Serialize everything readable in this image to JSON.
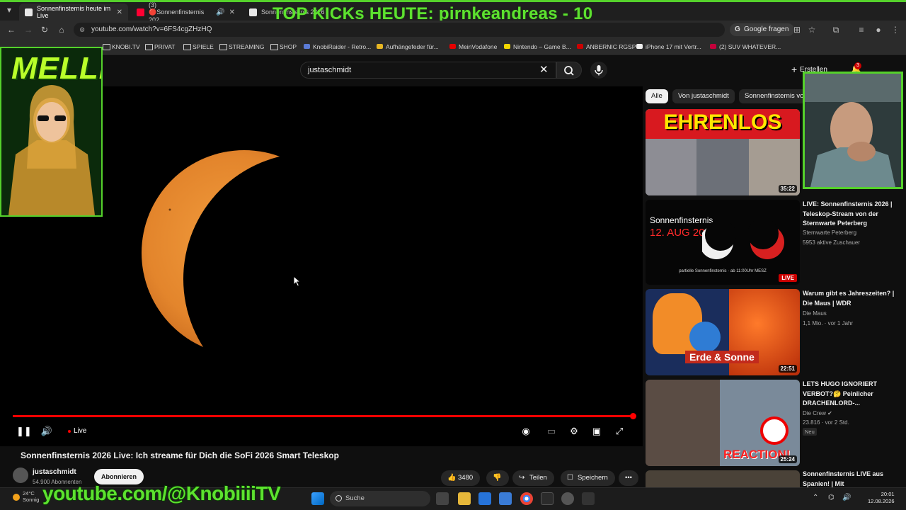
{
  "browser": {
    "tabs": [
      {
        "label": "Sonnenfinsternis heute im Live"
      },
      {
        "label": "(3) 🔴Sonnenfinsternis 202"
      },
      {
        "label": "Sonnenfinsternis 2026"
      }
    ],
    "url": "youtube.com/watch?v=6FS4cgZHzHQ",
    "google_ask": "Google fragen",
    "bookmarks": [
      "KNOBI.TV",
      "PRIVAT",
      "SPIELE",
      "STREAMING",
      "SHOP",
      "KnobiRaider - Retro...",
      "Aufhängefeder für...",
      "MeinVodafone",
      "Nintendo – Game B...",
      "ANBERNIC RGSP",
      "iPhone 17 mit Vertr...",
      "(2) SUV WHATEVER..."
    ]
  },
  "stream_overlay": {
    "banner": "TOP KICKs HEUTE: pirnkeandreas - 10",
    "melli": "MELLI",
    "youtube_handle": "youtube.com/@KnobiiiiTV"
  },
  "youtube": {
    "search_value": "justaschmidt",
    "create_label": "Erstellen",
    "notif_count": "3",
    "player": {
      "live_label": "Live",
      "progress_fraction": 0.99
    },
    "video": {
      "title": "Sonnenfinsternis 2026 Live: Ich streame für Dich die SoFi 2026 Smart Teleskop",
      "channel": "justaschmidt",
      "subscribers": "54.900 Abonnenten",
      "subscribe_label": "Abonnieren",
      "likes": "3480",
      "share_label": "Teilen",
      "save_label": "Speichern"
    },
    "chips": [
      "Alle",
      "Von justaschmidt",
      "Sonnenfinsternis vo"
    ],
    "recommendations": [
      {
        "thumb_text": "EHRENLOS",
        "duration": "35:22",
        "title": "",
        "channel": "",
        "meta": ""
      },
      {
        "thumb_title": "Sonnenfinsternis",
        "thumb_date": "12. AUG 2026",
        "thumb_caption": "partielle Sonnenfinsternis · ab 11:00Uhr MESZ",
        "live_badge": "LIVE",
        "title": "LIVE: Sonnenfinsternis 2026 | Teleskop-Stream von der Sternwarte Peterberg",
        "channel": "Sternwarte Peterberg",
        "meta": "5953 aktive Zuschauer"
      },
      {
        "thumb_text": "Erde & Sonne",
        "duration": "22:51",
        "title": "Warum gibt es Jahreszeiten? | Die Maus | WDR",
        "channel": "Die Maus",
        "meta": "1,1 Mio. · vor 1 Jahr"
      },
      {
        "thumb_text": "REACTION!",
        "duration": "25:24",
        "title": "LETS HUGO IGNORIERT VERBOT?🤔 Peinlicher DRACHENLORD-...",
        "channel": "Die Crew ✔",
        "meta": "23.816 · vor 2 Std.",
        "badge": "Neu"
      },
      {
        "title": "Sonnenfinsternis LIVE aus Spanien! | Mit"
      }
    ]
  },
  "taskbar": {
    "weather_temp": "24°C",
    "weather_desc": "Sonnig",
    "search_placeholder": "Suche",
    "time": "20:01",
    "date": "12.08.2026"
  }
}
